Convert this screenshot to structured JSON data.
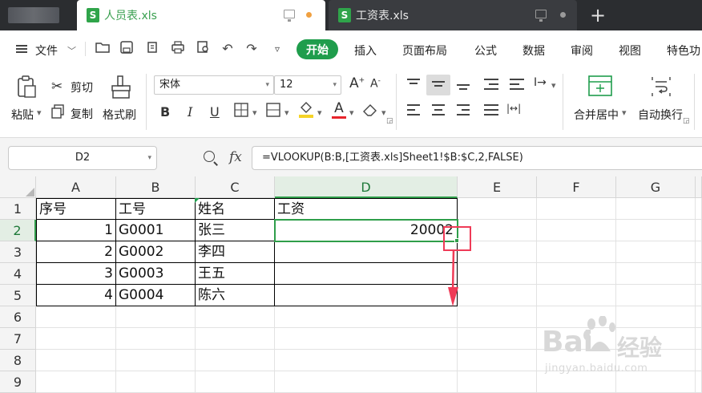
{
  "tabs": [
    {
      "label": "人员表.xls",
      "active": true
    },
    {
      "label": "工资表.xls",
      "active": false
    }
  ],
  "menu": {
    "file_label": "文件",
    "tabs": [
      "开始",
      "插入",
      "页面布局",
      "公式",
      "数据",
      "审阅",
      "视图",
      "特色功"
    ],
    "active_tab": "开始"
  },
  "ribbon": {
    "paste_label": "粘贴",
    "cut_label": "剪切",
    "copy_label": "复制",
    "format_painter_label": "格式刷",
    "font_name": "宋体",
    "font_size": "12",
    "bold": "B",
    "italic": "I",
    "underline": "U",
    "merge_label": "合并居中",
    "wrap_label": "自动换行"
  },
  "formula_bar": {
    "name_box": "D2",
    "fx": "fx",
    "formula": "=VLOOKUP(B:B,[工资表.xls]Sheet1!$B:$C,2,FALSE)"
  },
  "sheet": {
    "columns": [
      "A",
      "B",
      "C",
      "D",
      "E",
      "F",
      "G"
    ],
    "rows": [
      "1",
      "2",
      "3",
      "4",
      "5",
      "6",
      "7",
      "8",
      "9"
    ],
    "selected_cell": "D2",
    "cells": {
      "A1": "序号",
      "B1": "工号",
      "C1": "姓名",
      "D1": "工资",
      "A2": "1",
      "B2": "G0001",
      "C2": "张三",
      "D2": "20002",
      "A3": "2",
      "B3": "G0002",
      "C3": "李四",
      "A4": "3",
      "B4": "G0003",
      "C4": "王五",
      "A5": "4",
      "B5": "G0004",
      "C5": "陈六"
    }
  },
  "watermark": {
    "brand": "Bai",
    "brand2": "经验",
    "url": "jingyan.baidu.com"
  },
  "colors": {
    "accent": "#1f9d4c",
    "selection": "#2f9e4a",
    "annotation": "#ef3b57",
    "tabbar": "#2b2d30"
  }
}
